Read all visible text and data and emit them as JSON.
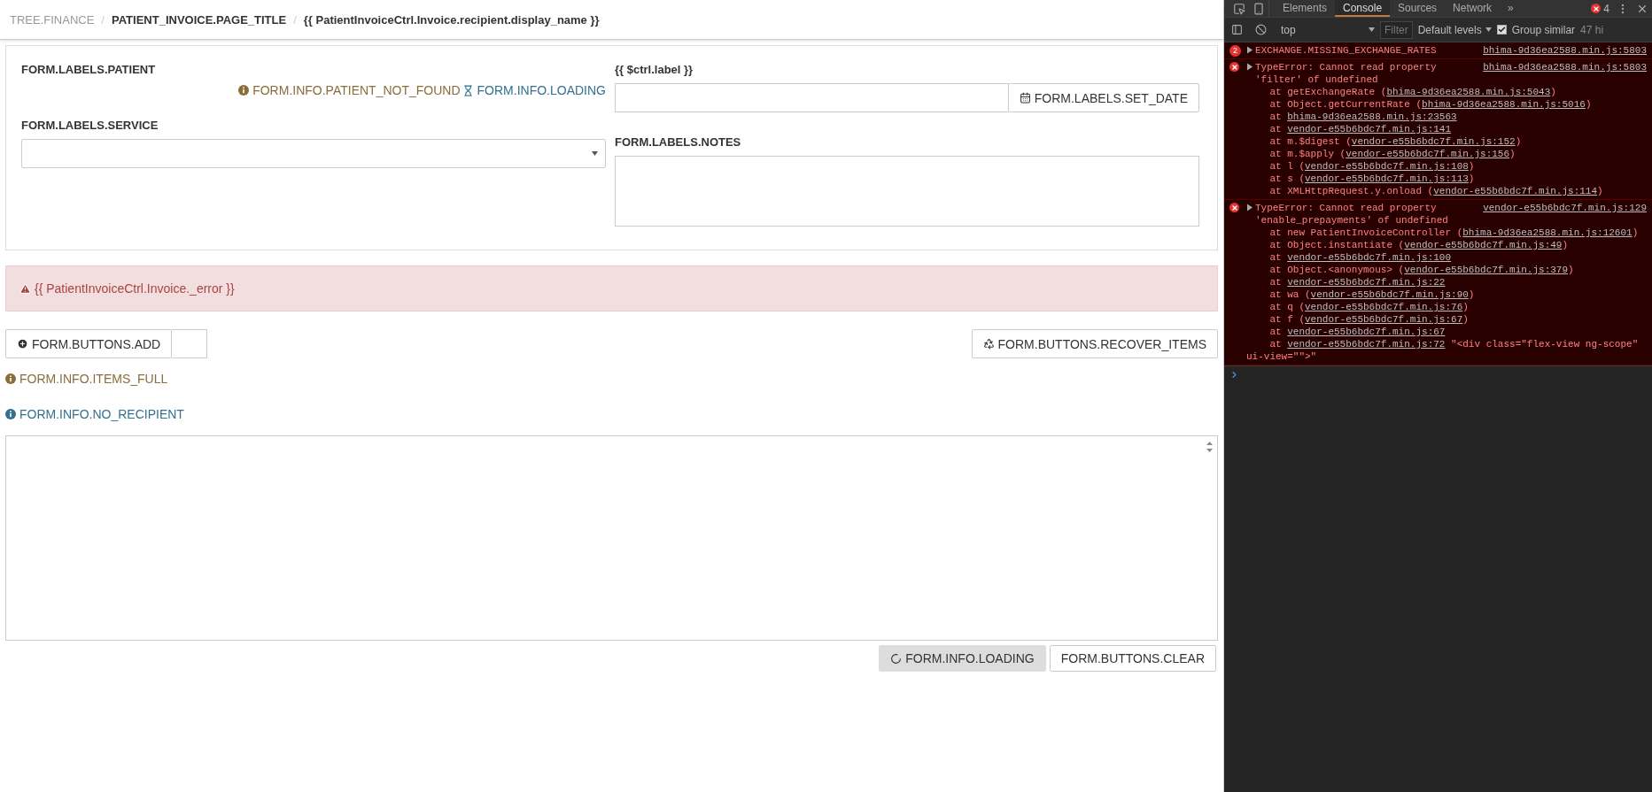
{
  "breadcrumb": [
    {
      "label": "TREE.FINANCE",
      "kind": "link"
    },
    {
      "label": "PATIENT_INVOICE.PAGE_TITLE",
      "kind": "current",
      "separator": "/"
    },
    {
      "label": "{{ PatientInvoiceCtrl.Invoice.recipient.display_name }}",
      "kind": "current",
      "separator": "/"
    }
  ],
  "form": {
    "patient": {
      "label": "FORM.LABELS.PATIENT",
      "messages": [
        {
          "kind": "warning",
          "text": "FORM.INFO.PATIENT_NOT_FOUND"
        },
        {
          "kind": "loading",
          "text": "FORM.INFO.LOADING"
        }
      ]
    },
    "service": {
      "label": "FORM.LABELS.SERVICE"
    },
    "date": {
      "label": "{{ $ctrl.label }}",
      "button": "FORM.LABELS.SET_DATE"
    },
    "notes": {
      "label": "FORM.LABELS.NOTES"
    }
  },
  "alert": {
    "text": "{{ PatientInvoiceCtrl.Invoice._error }}"
  },
  "toolbar": {
    "add_button": "FORM.BUTTONS.ADD",
    "recover_button": "FORM.BUTTONS.RECOVER_ITEMS"
  },
  "notices": [
    {
      "kind": "warning",
      "text": "FORM.INFO.ITEMS_FULL"
    },
    {
      "kind": "info",
      "text": "FORM.INFO.NO_RECIPIENT"
    }
  ],
  "footer_buttons": [
    {
      "label": "FORM.INFO.LOADING",
      "kind": "loading",
      "disabled": true
    },
    {
      "label": "FORM.BUTTONS.CLEAR",
      "kind": "plain",
      "disabled": false
    }
  ],
  "devtools": {
    "tabs": [
      {
        "label": "Elements",
        "selected": false
      },
      {
        "label": "Console",
        "selected": true
      },
      {
        "label": "Sources",
        "selected": false
      },
      {
        "label": "Network",
        "selected": false
      }
    ],
    "more_tabs": "»",
    "error_count": "4",
    "context": "top",
    "filter": {
      "placeholder": "Filter"
    },
    "levels": "Default levels",
    "group_similar": {
      "label": "Group similar",
      "checked": true
    },
    "hidden_count": "47 hi",
    "messages": [
      {
        "count": "2",
        "text": "EXCHANGE.MISSING_EXCHANGE_RATES",
        "source": "bhima-9d36ea2588.min.js:5803"
      },
      {
        "text": "TypeError: Cannot read property 'filter' of undefined",
        "source": "bhima-9d36ea2588.min.js:5803",
        "stack": [
          {
            "prefix": "at getExchangeRate (",
            "link": "bhima-9d36ea2588.min.js:5043",
            "suffix": ")"
          },
          {
            "prefix": "at Object.getCurrentRate (",
            "link": "bhima-9d36ea2588.min.js:5016",
            "suffix": ")"
          },
          {
            "prefix": "at ",
            "link": "bhima-9d36ea2588.min.js:23563"
          },
          {
            "prefix": "at ",
            "link": "vendor-e55b6bdc7f.min.js:141"
          },
          {
            "prefix": "at m.$digest (",
            "link": "vendor-e55b6bdc7f.min.js:152",
            "suffix": ")"
          },
          {
            "prefix": "at m.$apply (",
            "link": "vendor-e55b6bdc7f.min.js:156",
            "suffix": ")"
          },
          {
            "prefix": "at l (",
            "link": "vendor-e55b6bdc7f.min.js:108",
            "suffix": ")"
          },
          {
            "prefix": "at s (",
            "link": "vendor-e55b6bdc7f.min.js:113",
            "suffix": ")"
          },
          {
            "prefix": "at XMLHttpRequest.y.onload (",
            "link": "vendor-e55b6bdc7f.min.js:114",
            "suffix": ")"
          }
        ]
      },
      {
        "text": "TypeError: Cannot read property 'enable_prepayments' of undefined",
        "source": "vendor-e55b6bdc7f.min.js:129",
        "stack": [
          {
            "prefix": "at new PatientInvoiceController (",
            "link": "bhima-9d36ea2588.min.js:12601",
            "suffix": ")"
          },
          {
            "prefix": "at Object.instantiate (",
            "link": "vendor-e55b6bdc7f.min.js:49",
            "suffix": ")"
          },
          {
            "prefix": "at ",
            "link": "vendor-e55b6bdc7f.min.js:100"
          },
          {
            "prefix": "at Object.<anonymous> (",
            "link": "vendor-e55b6bdc7f.min.js:379",
            "suffix": ")"
          },
          {
            "prefix": "at ",
            "link": "vendor-e55b6bdc7f.min.js:22"
          },
          {
            "prefix": "at wa (",
            "link": "vendor-e55b6bdc7f.min.js:90",
            "suffix": ")"
          },
          {
            "prefix": "at q (",
            "link": "vendor-e55b6bdc7f.min.js:76",
            "suffix": ")"
          },
          {
            "prefix": "at f (",
            "link": "vendor-e55b6bdc7f.min.js:67",
            "suffix": ")"
          },
          {
            "prefix": "at ",
            "link": "vendor-e55b6bdc7f.min.js:67"
          },
          {
            "prefix": "at ",
            "link": "vendor-e55b6bdc7f.min.js:72",
            "suffix": " \"<div class=\"flex-view ng-scope\" ui-view=\"\">\""
          }
        ]
      }
    ]
  }
}
